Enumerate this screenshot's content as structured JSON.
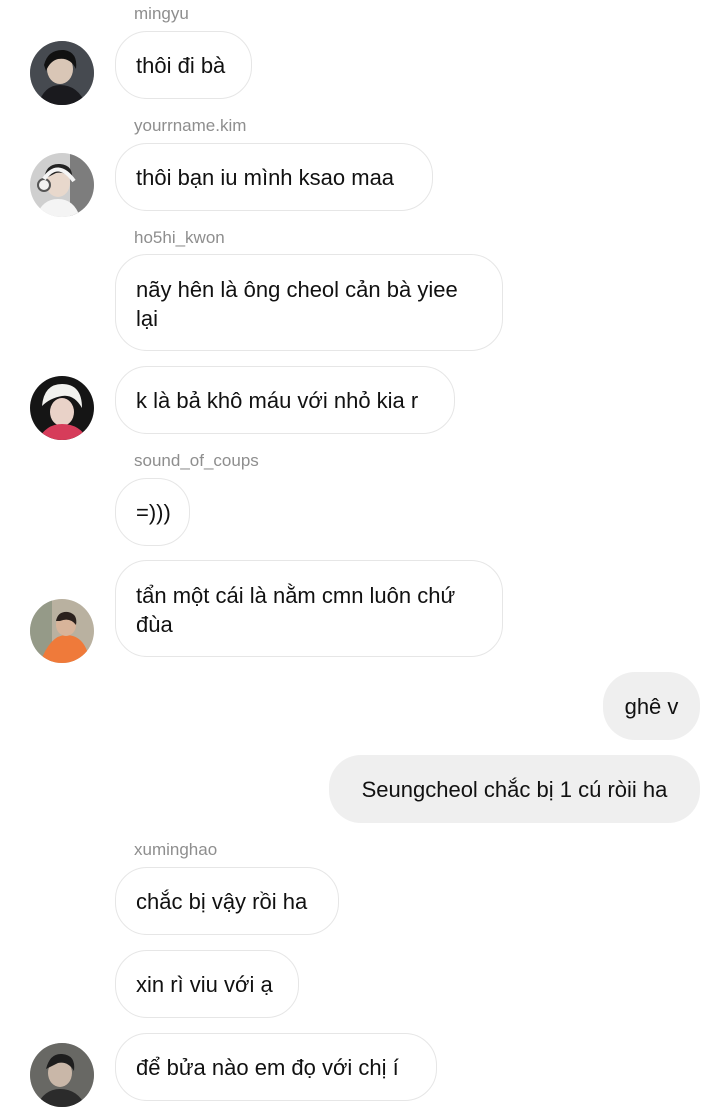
{
  "thread": {
    "messages": [
      {
        "sender": "mingyu",
        "text": "thôi đi bà",
        "avatar": "avatar-photo-dark-hair-young-man"
      },
      {
        "sender": "yourrname.kim",
        "text": "thôi bạn iu mình ksao maa",
        "avatar": "avatar-photo-headphones"
      },
      {
        "sender": "ho5hi_kwon",
        "text": "nãy hên là ông cheol cản bà yiee lại"
      },
      {
        "sender": "ho5hi_kwon",
        "text": "k là bả khô máu với nhỏ kia r",
        "avatar": "avatar-photo-blond-hair"
      },
      {
        "sender": "sound_of_coups",
        "text": "=)))"
      },
      {
        "sender": "sound_of_coups",
        "text": "tẩn một cái là nằm cmn luôn chứ đùa",
        "avatar": "avatar-photo-orange-sweater"
      },
      {
        "sender": "me",
        "text": "ghê v"
      },
      {
        "sender": "me",
        "text": "Seungcheol chắc bị 1 cú ròii ha"
      },
      {
        "sender": "xuminghao",
        "text": "chắc bị vậy rồi ha"
      },
      {
        "sender": "xuminghao",
        "text": "xin rì viu với ạ"
      },
      {
        "sender": "xuminghao",
        "text": "để bửa nào em đọ với chị í",
        "avatar": "avatar-photo-dark-portrait"
      }
    ]
  },
  "colors": {
    "username": "#8e8e8e",
    "received_bubble_border": "#e6e6e6",
    "sent_bubble_bg": "#efefef",
    "text": "#111111"
  }
}
